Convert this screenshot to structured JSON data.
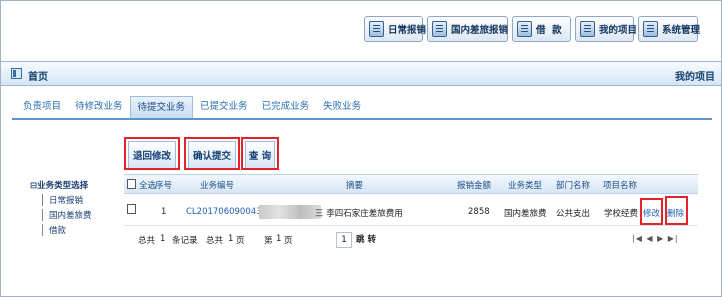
{
  "toolbar": {
    "buttons": [
      {
        "label": "日常报销",
        "icon": "document-icon"
      },
      {
        "label": "国内差旅报销",
        "icon": "luggage-icon"
      },
      {
        "label": "借  款",
        "icon": "loan-icon"
      },
      {
        "label": "我的项目",
        "icon": "project-icon"
      },
      {
        "label": "系统管理",
        "icon": "settings-icon"
      }
    ]
  },
  "titlebar": {
    "home": "首页",
    "right": "我的项目"
  },
  "tabs": [
    "负责项目",
    "待修改业务",
    "待提交业务",
    "已提交业务",
    "已完成业务",
    "失败业务"
  ],
  "active_tab": "待提交业务",
  "tree": {
    "root": "业务类型选择",
    "items": [
      "日常报销",
      "国内差旅费",
      "借款"
    ]
  },
  "actions": {
    "withdraw": "退回修改",
    "confirm": "确认提交",
    "query": "查 询"
  },
  "table": {
    "headers": {
      "select_all": "全选",
      "seq": "序号",
      "code": "业务编号",
      "summary": "摘要",
      "amount": "报销金额",
      "type": "业务类型",
      "dept": "部门名称",
      "project": "项目名称"
    },
    "row": {
      "seq": "1",
      "code": "CL201706090043",
      "summary": "三 李四石家庄差旅费用",
      "amount": "2858",
      "type": "国内差旅费",
      "dept": "公共支出",
      "project": "学校经费",
      "edit": "修改",
      "delete": "删除"
    }
  },
  "pager": {
    "total_label": "总共",
    "total_records": "1",
    "records_label": "条记录",
    "total_pages_label": "总共",
    "total_pages": "1",
    "page_unit": "页",
    "page_label": "第",
    "current_page": "1",
    "page_unit2": "页",
    "input_value": "1",
    "jump": "跳 转",
    "nav": "|◀ ◀ ▶ ▶|"
  },
  "colors": {
    "accent": "#2c6fb0",
    "highlight": "#e0242a",
    "tab_line": "#5d96cf"
  }
}
